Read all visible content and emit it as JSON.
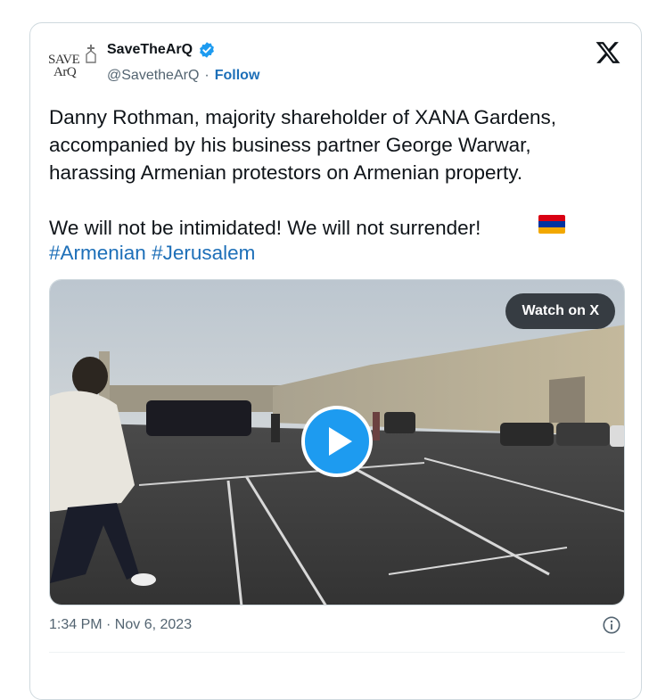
{
  "author": {
    "display_name": "SaveTheArQ",
    "handle": "@SavetheArQ",
    "separator": "·",
    "follow_label": "Follow",
    "avatar_line1": "SAVE",
    "avatar_line2": "ArQ"
  },
  "tweet": {
    "text": "Danny Rothman, majority shareholder of XANA Gardens, accompanied by his business partner George Warwar, harassing Armenian protestors on Armenian property.\n\nWe will not be intimidated! We will not surrender!",
    "hashtags": [
      "#Armenian",
      "#Jerusalem"
    ],
    "flag": "armenia-flag",
    "flag_colors": [
      "#d90012",
      "#0033a0",
      "#f2a800"
    ]
  },
  "media": {
    "watch_label": "Watch on X",
    "play_icon": "play-icon"
  },
  "footer": {
    "timestamp": "1:34 PM · Nov 6, 2023",
    "info_icon": "info-icon"
  },
  "colors": {
    "link": "#1d6fb8",
    "verified": "#1d9bf0",
    "text_secondary": "#536471"
  }
}
